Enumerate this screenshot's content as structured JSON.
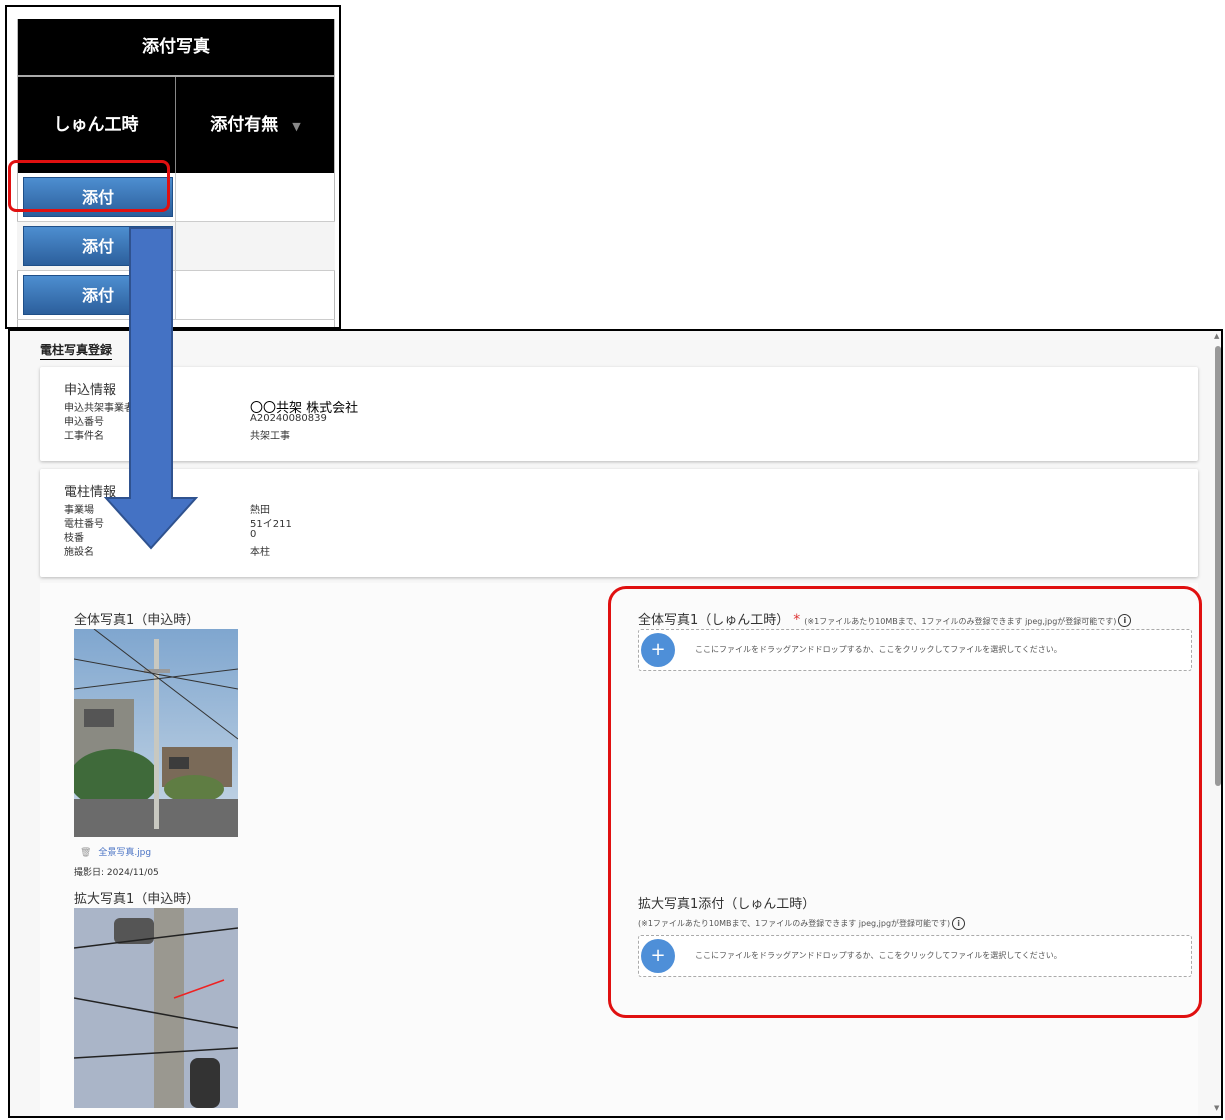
{
  "table": {
    "group_header": "添付写真",
    "col_shunkou": "しゅん工時",
    "col_attached": "添付有無",
    "filter_icon": "filter-icon",
    "rows": [
      {
        "button": "添付"
      },
      {
        "button": "添付"
      },
      {
        "button": "添付"
      }
    ]
  },
  "page_title": "電柱写真登録",
  "application_info": {
    "title": "申込情報",
    "labels": [
      "申込共架事業者",
      "申込番号",
      "工事件名"
    ],
    "values": [
      "〇〇共架  株式会社",
      "A20240080839",
      "共架工事"
    ]
  },
  "pole_info": {
    "title": "電柱情報",
    "labels": [
      "事業場",
      "電柱番号",
      "枝番",
      "施設名"
    ],
    "values": [
      "熱田",
      "51イ211",
      "0",
      "本柱"
    ]
  },
  "photos": {
    "overall_title": "全体写真1（申込時）",
    "overall_file": "全景写真.jpg",
    "overall_date": "撮影日: 2024/11/05",
    "zoom_title": "拡大写真1（申込時）"
  },
  "upload": {
    "overall_title": "全体写真1（しゅん工時）",
    "required_mark": "*",
    "hint": "(※1ファイルあたり10MBまで、1ファイルのみ登録できます jpeg,jpgが登録可能です)",
    "drop_text": "ここにファイルをドラッグアンドドロップするか、ここをクリックしてファイルを選択してください。",
    "zoom_title": "拡大写真1添付（しゅん工時）",
    "zoom_hint": "(※1ファイルあたり10MBまで、1ファイルのみ登録できます jpeg,jpgが登録可能です)",
    "plus": "+",
    "info": "i"
  },
  "colors": {
    "accent_blue": "#4e8fd8",
    "highlight_red": "#e01010",
    "arrow_blue": "#4472c4"
  }
}
